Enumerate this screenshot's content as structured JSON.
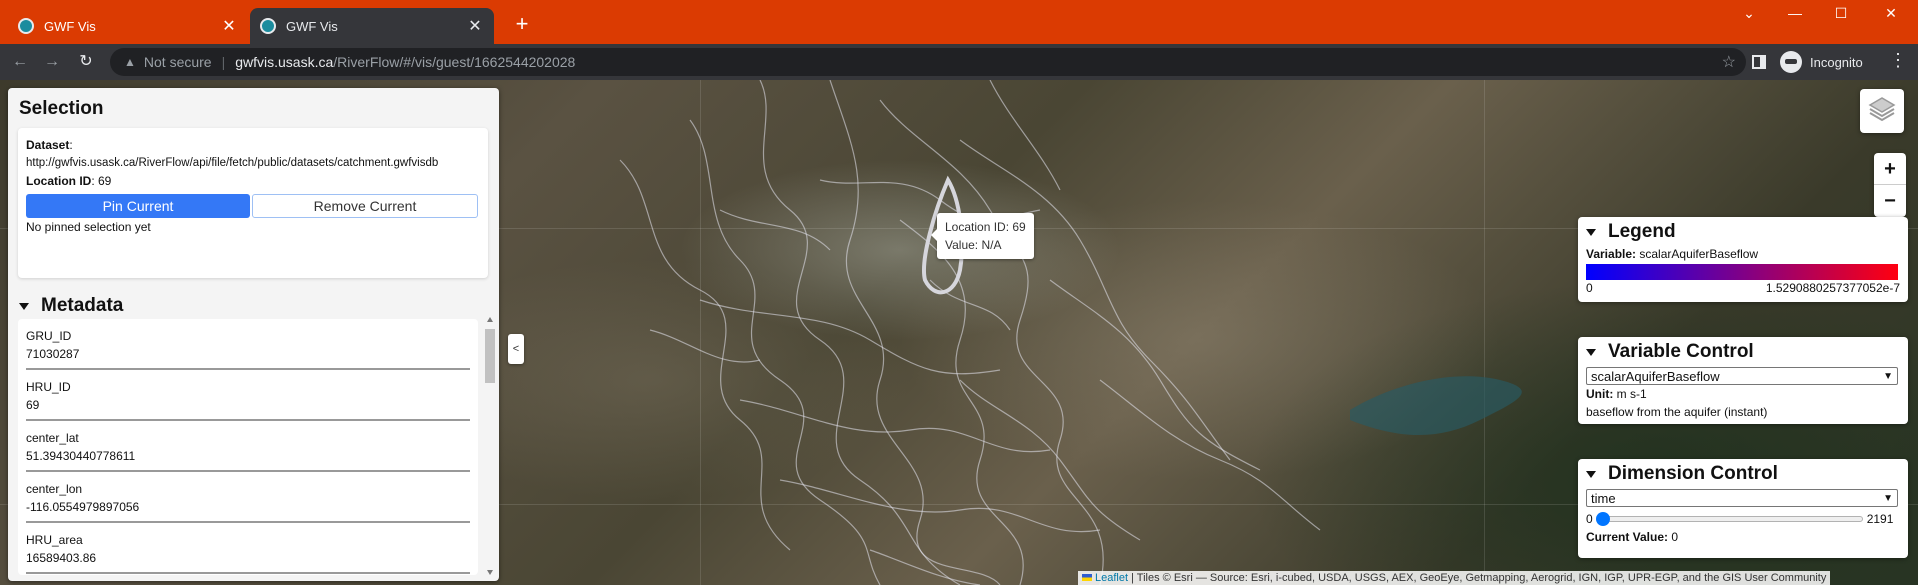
{
  "browser": {
    "tabs": [
      {
        "title": "GWF Vis",
        "active": false
      },
      {
        "title": "GWF Vis",
        "active": true
      }
    ],
    "new_tab": "+",
    "window_controls": {
      "minimize": "⌄",
      "min": "—",
      "max": "☐",
      "close": "✕"
    },
    "security": "Not secure",
    "url_host": "gwfvis.usask.ca",
    "url_path": "/RiverFlow/#/vis/guest/1662544202028",
    "profile": "Incognito",
    "accent_color": "#db3b02"
  },
  "selection": {
    "title": "Selection",
    "dataset_label": "Dataset",
    "dataset_colon": ":",
    "dataset_url": "http://gwfvis.usask.ca/RiverFlow/api/file/fetch/public/datasets/catchment.gwfvisdb",
    "location_label": "Location ID",
    "location_value": ": 69",
    "pin_button": "Pin Current",
    "remove_button": "Remove Current",
    "no_pinned": "No pinned selection yet"
  },
  "metadata": {
    "title": "Metadata",
    "items": [
      {
        "key": "GRU_ID",
        "value": "71030287"
      },
      {
        "key": "HRU_ID",
        "value": "69"
      },
      {
        "key": "center_lat",
        "value": "51.39430440778611"
      },
      {
        "key": "center_lon",
        "value": "-116.0554979897056"
      },
      {
        "key": "HRU_area",
        "value": "16589403.86"
      }
    ]
  },
  "collapse_label": "<",
  "tooltip": {
    "location": "Location ID: 69",
    "value": "Value: N/A"
  },
  "zoom": {
    "in": "+",
    "out": "−"
  },
  "legend": {
    "title": "Legend",
    "variable_label": "Variable:",
    "variable": "scalarAquiferBaseflow",
    "min": "0",
    "max": "1.5290880257377052e-7",
    "color_low": "#0000ff",
    "color_high": "#ff0010"
  },
  "variable_control": {
    "title": "Variable Control",
    "selected": "scalarAquiferBaseflow",
    "unit_label": "Unit:",
    "unit": "m s-1",
    "description": "baseflow from the aquifer (instant)"
  },
  "dimension_control": {
    "title": "Dimension Control",
    "selected": "time",
    "slider_min": "0",
    "slider_max": "2191",
    "slider_fraction": 0,
    "current_label": "Current Value:",
    "current_value": "0"
  },
  "attribution": {
    "leaflet": "Leaflet",
    "text": " | Tiles © Esri — Source: Esri, i-cubed, USDA, USGS, AEX, GeoEye, Getmapping, Aerogrid, IGN, IGP, UPR-EGP, and the GIS User Community"
  }
}
